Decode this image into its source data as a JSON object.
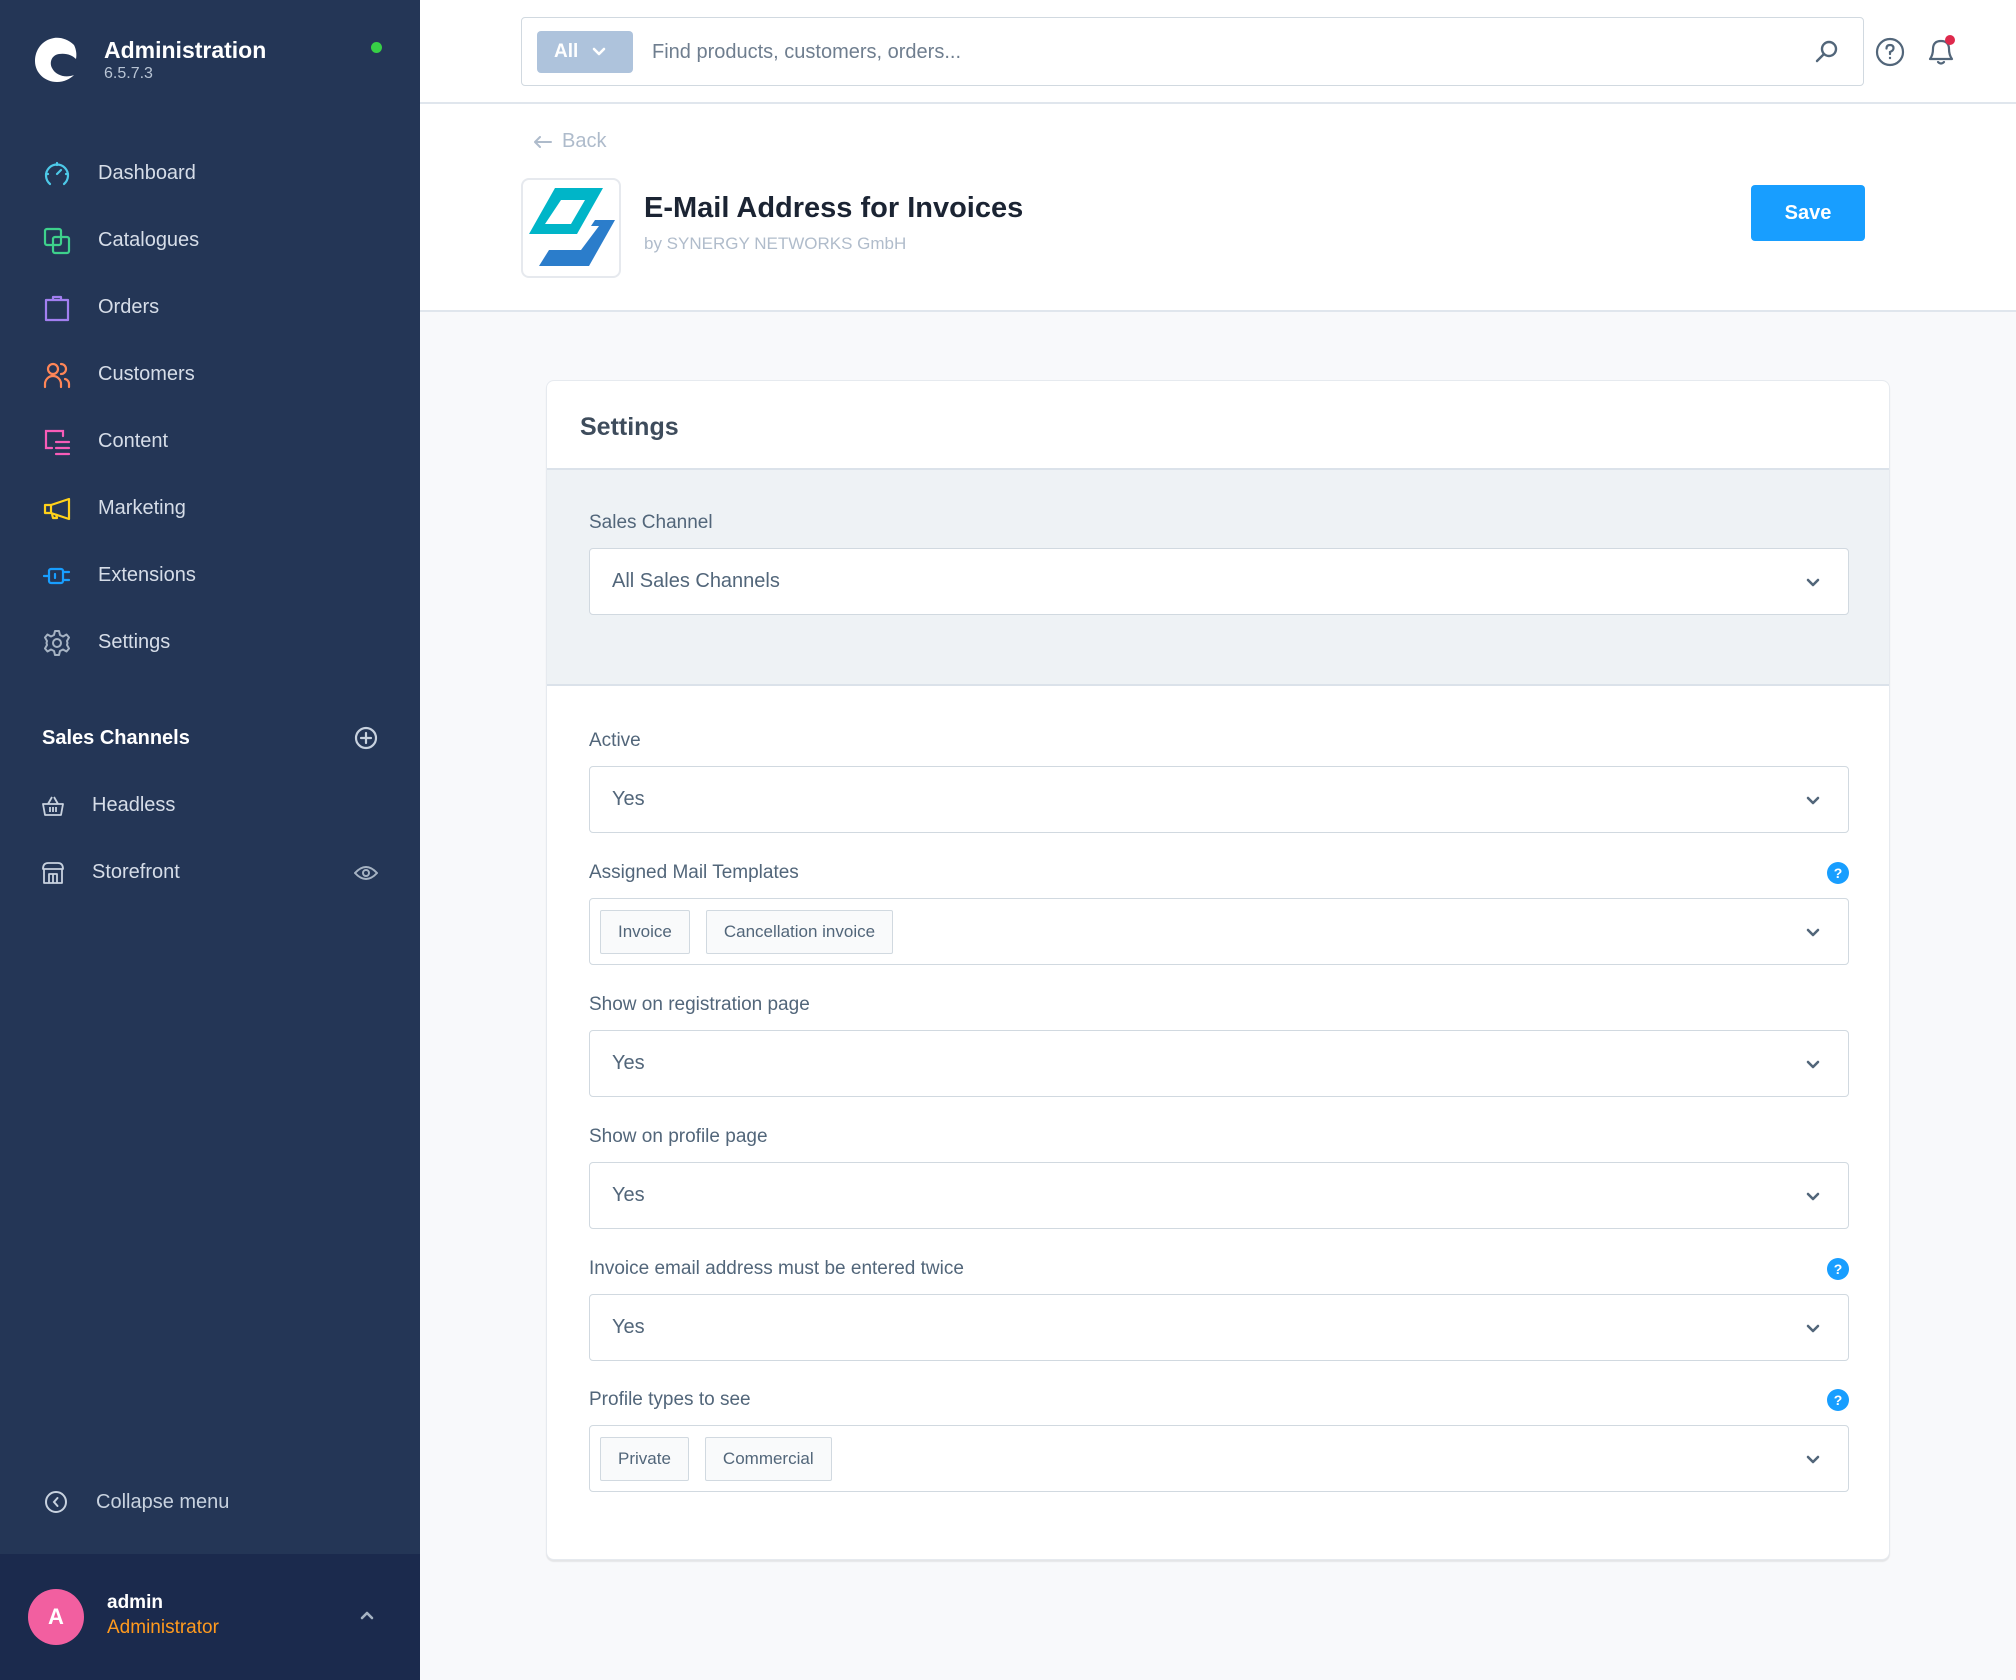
{
  "app": {
    "title": "Administration",
    "version": "6.5.7.3",
    "status_color": "#37d046"
  },
  "sidebar": {
    "items": [
      {
        "label": "Dashboard",
        "icon": "dashboard-icon",
        "color": "#4dc9e8"
      },
      {
        "label": "Catalogues",
        "icon": "catalogues-icon",
        "color": "#3ed18c"
      },
      {
        "label": "Orders",
        "icon": "orders-icon",
        "color": "#a27ff0"
      },
      {
        "label": "Customers",
        "icon": "customers-icon",
        "color": "#ff8657"
      },
      {
        "label": "Content",
        "icon": "content-icon",
        "color": "#f75cb8"
      },
      {
        "label": "Marketing",
        "icon": "marketing-icon",
        "color": "#ffd11a"
      },
      {
        "label": "Extensions",
        "icon": "extensions-icon",
        "color": "#189eff"
      },
      {
        "label": "Settings",
        "icon": "settings-icon",
        "color": "#a6b3c3"
      }
    ],
    "sales_channels": {
      "title": "Sales Channels",
      "items": [
        {
          "label": "Headless",
          "icon": "basket-icon"
        },
        {
          "label": "Storefront",
          "icon": "storefront-icon"
        }
      ]
    },
    "collapse_label": "Collapse menu",
    "user": {
      "initial": "A",
      "name": "admin",
      "role": "Administrator"
    }
  },
  "topbar": {
    "search_type": "All",
    "search_placeholder": "Find products, customers, orders..."
  },
  "plugin": {
    "back_label": "Back",
    "title": "E-Mail Address for Invoices",
    "vendor": "by SYNERGY NETWORKS GmbH",
    "save_label": "Save",
    "accent": "#189eff"
  },
  "settings": {
    "title": "Settings",
    "sales_channel": {
      "label": "Sales Channel",
      "value": "All Sales Channels"
    },
    "fields": [
      {
        "label": "Active",
        "value": "Yes",
        "help": false
      },
      {
        "label": "Assigned Mail Templates",
        "tags": [
          "Invoice",
          "Cancellation invoice"
        ],
        "help": true
      },
      {
        "label": "Show on registration page",
        "value": "Yes",
        "help": false
      },
      {
        "label": "Show on profile page",
        "value": "Yes",
        "help": false
      },
      {
        "label": "Invoice email address must be entered twice",
        "value": "Yes",
        "help": true
      },
      {
        "label": "Profile types to see",
        "tags": [
          "Private",
          "Commercial"
        ],
        "help": true
      }
    ],
    "help_glyph": "?"
  }
}
